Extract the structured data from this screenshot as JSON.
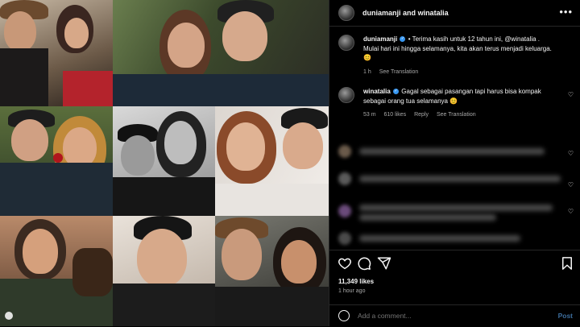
{
  "post": {
    "header": {
      "username": "duniamanji",
      "connector": "and",
      "collaborator": "winatalia"
    },
    "caption": {
      "username": "duniamanji",
      "text": "• Terima kasih untuk 12 tahun ini, @winatalia . Mulai hari ini hingga selamanya, kita akan terus menjadi keluarga. 😊",
      "age": "1 h",
      "see_translation": "See Translation"
    },
    "reply": {
      "username": "winatalia",
      "text": "Gagal sebagai pasangan tapi harus bisa kompak sebagai orang tua selamanya 😊",
      "age": "53 m",
      "likes": "610 likes",
      "reply_label": "Reply",
      "see_translation": "See Translation"
    },
    "likes_count": "11,349 likes",
    "posted_ago": "1 hour ago",
    "comment_placeholder": "Add a comment...",
    "post_label": "Post"
  },
  "icons": {
    "more": "more-horizontal-icon",
    "like": "heart-icon",
    "comment": "comment-icon",
    "share": "share-icon",
    "save": "bookmark-icon",
    "emoji": "emoji-icon"
  },
  "colors": {
    "background": "#000000",
    "text": "#f5f5f5",
    "muted": "#a8a8a8",
    "verified": "#3897f0",
    "post_link": "#3c6d9c"
  }
}
